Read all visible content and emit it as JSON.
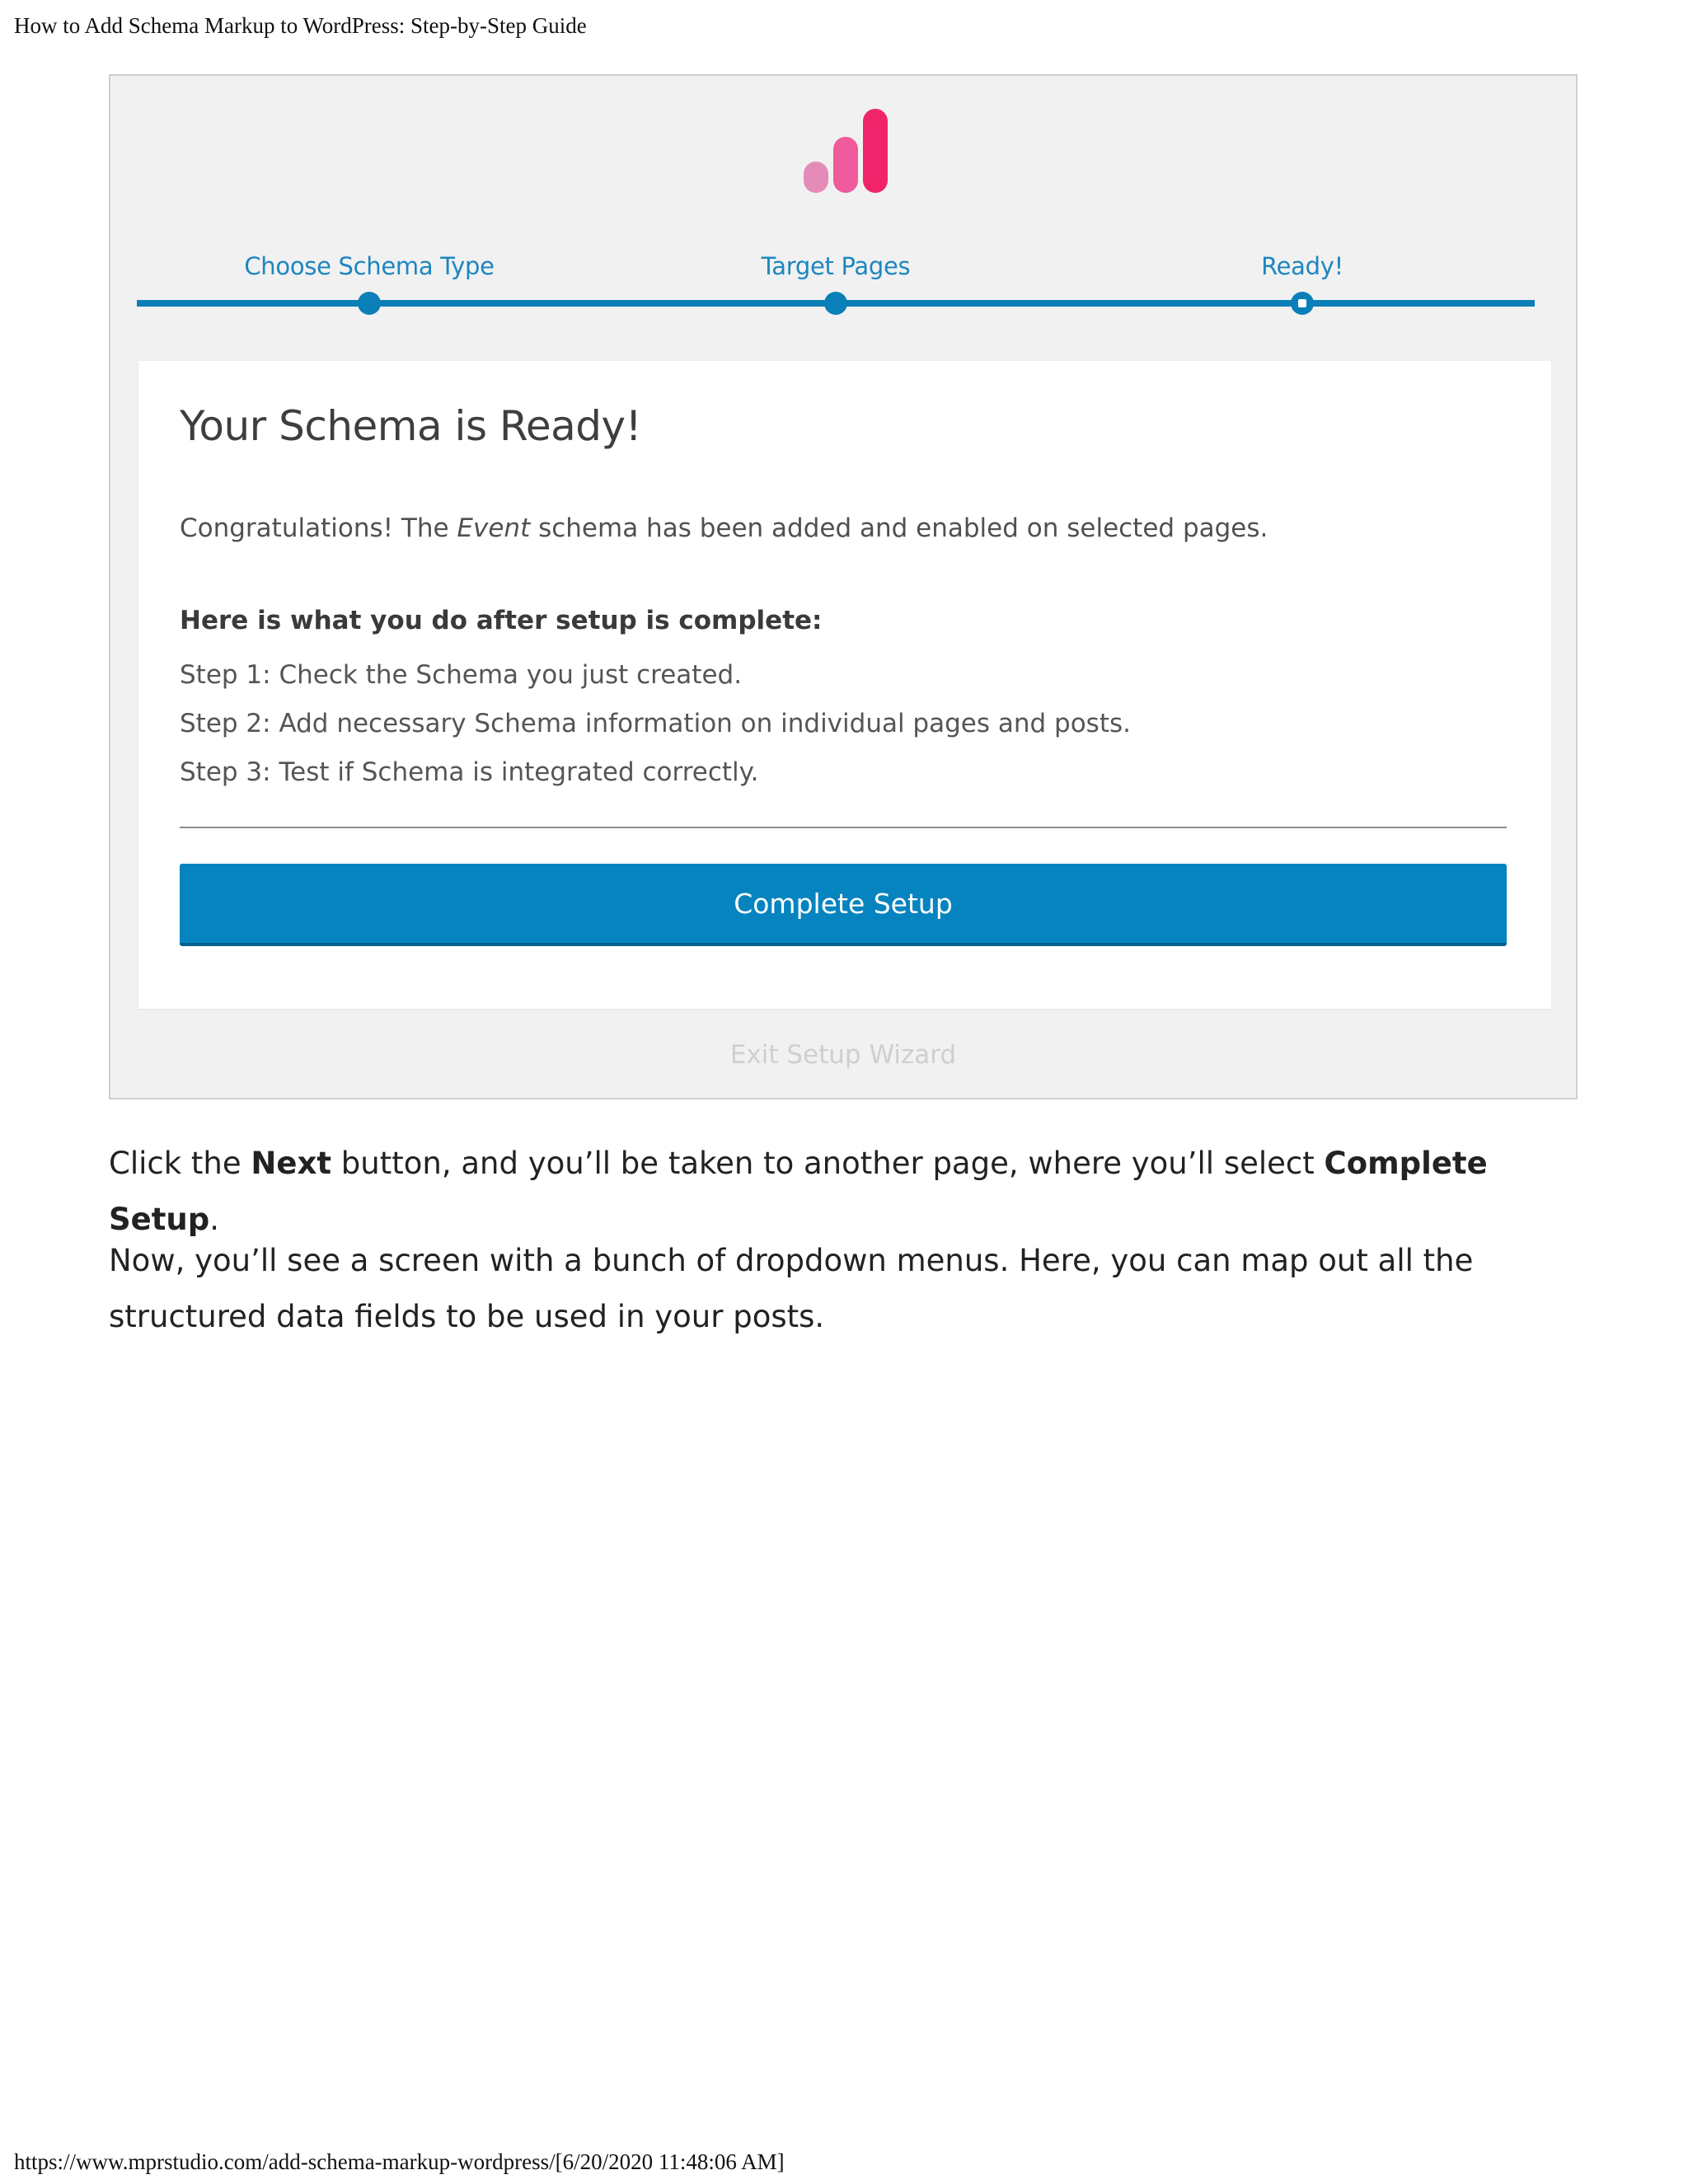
{
  "print": {
    "header_title": "How to Add Schema Markup to WordPress: Step-by-Step Guide",
    "footer_url": "https://www.mprstudio.com/add-schema-markup-wordpress/[6/20/2020 11:48:06 AM]"
  },
  "wizard": {
    "logo_icon": "bar-chart-logo-icon",
    "colors": {
      "accent": "#0a7fb8",
      "button": "#0584c0",
      "logo_light": "#e58bb8",
      "logo_mid": "#ef5b9c",
      "logo_dark": "#f0246a"
    },
    "steps": [
      {
        "label": "Choose Schema Type"
      },
      {
        "label": "Target Pages"
      },
      {
        "label": "Ready!"
      }
    ],
    "card": {
      "title": "Your Schema is Ready!",
      "congrats_before": "Congratulations! The ",
      "congrats_em": "Event",
      "congrats_after": " schema has been added and enabled on selected pages.",
      "after_heading": "Here is what you do after setup is complete:",
      "steps": [
        "Step 1: Check the Schema you just created.",
        "Step 2: Add necessary Schema information on individual pages and posts.",
        "Step 3: Test if Schema is integrated correctly."
      ],
      "button_label": "Complete Setup"
    },
    "exit_label": "Exit Setup Wizard"
  },
  "article": {
    "p1_before": "Click the ",
    "p1_bold1": "Next",
    "p1_mid": " button, and you’ll be taken to another page, where you’ll select ",
    "p1_bold2": "Complete Setup",
    "p1_after": ".",
    "p2": "Now, you’ll see a screen with a bunch of dropdown menus. Here, you can map out all the structured data fields to be used in your posts."
  }
}
